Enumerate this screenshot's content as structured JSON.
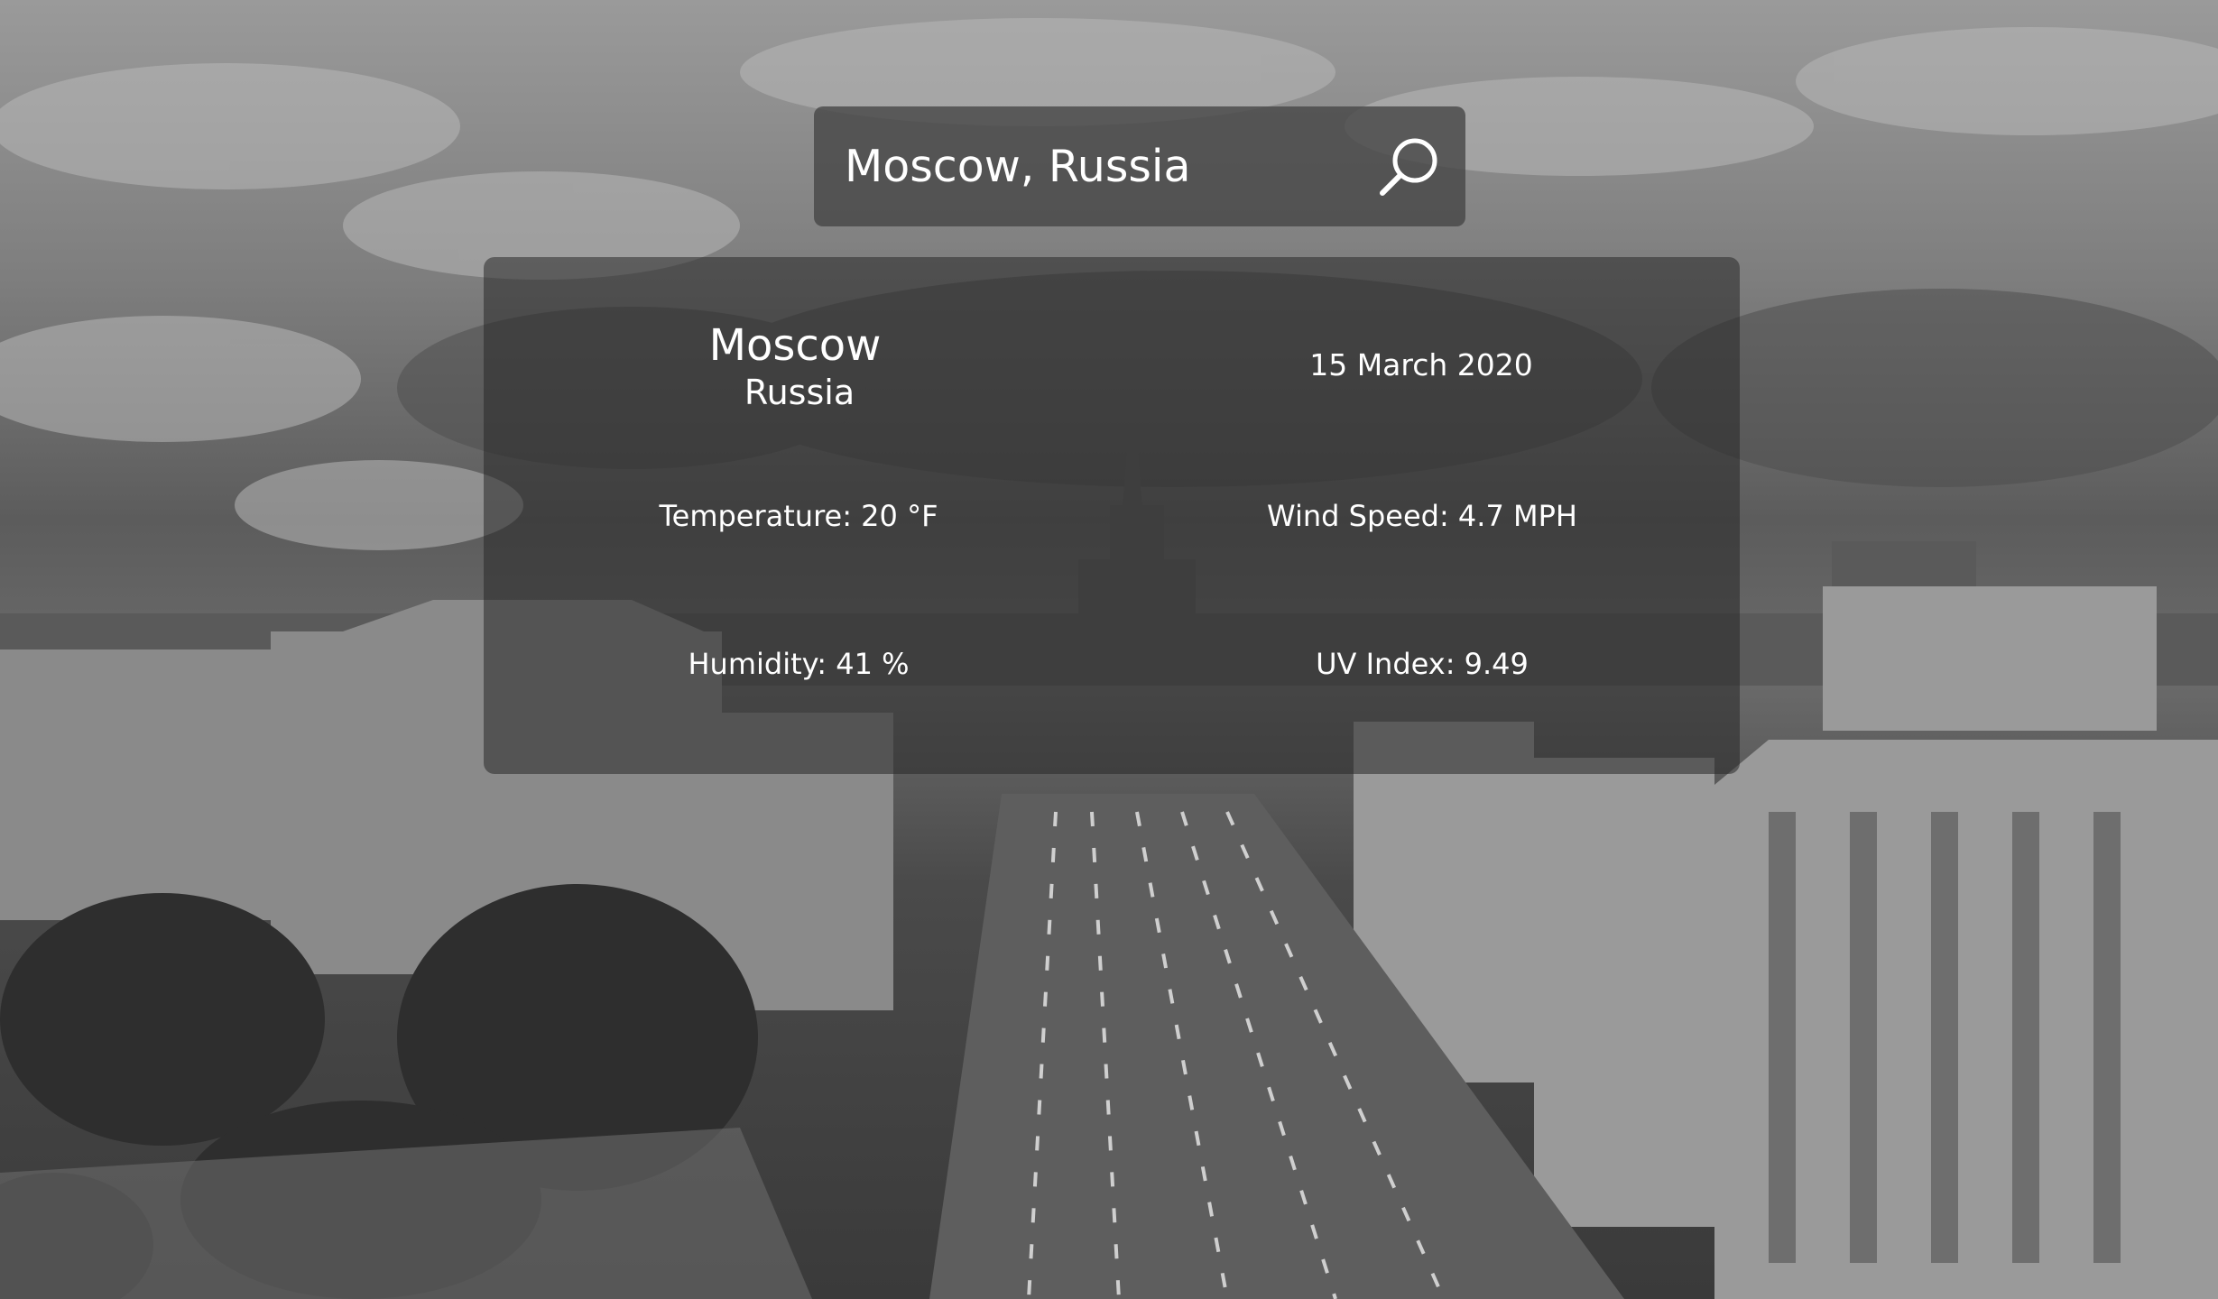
{
  "search": {
    "value": "Moscow, Russia",
    "icon": "search-icon"
  },
  "weather": {
    "city": "Moscow",
    "country": "Russia",
    "date": "15 March 2020",
    "temperature": "Temperature: 20 °F",
    "wind_speed": "Wind Speed: 4.7 MPH",
    "humidity": "Humidity: 41 %",
    "uv_index": "UV Index: 9.49"
  }
}
